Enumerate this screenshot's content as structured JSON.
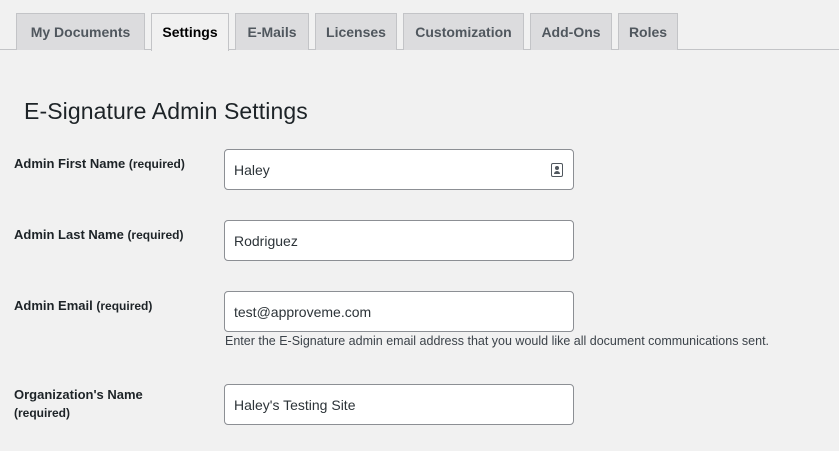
{
  "tabs": [
    {
      "label": "My Documents",
      "active": false
    },
    {
      "label": "Settings",
      "active": true
    },
    {
      "label": "E-Mails",
      "active": false
    },
    {
      "label": "Licenses",
      "active": false
    },
    {
      "label": "Customization",
      "active": false
    },
    {
      "label": "Add-Ons",
      "active": false
    },
    {
      "label": "Roles",
      "active": false
    }
  ],
  "page_title": "E-Signature Admin Settings",
  "fields": {
    "first_name": {
      "label": "Admin First Name",
      "required": "(required)",
      "value": "Haley",
      "icon": "contact-card-icon"
    },
    "last_name": {
      "label": "Admin Last Name",
      "required": "(required)",
      "value": "Rodriguez"
    },
    "email": {
      "label": "Admin Email",
      "required": "(required)",
      "value": "test@approveme.com",
      "help": "Enter the E-Signature admin email address that you would like all document communications sent."
    },
    "org_name": {
      "label": "Organization's Name",
      "required": "(required)",
      "value": "Haley's Testing Site"
    }
  },
  "colors": {
    "background": "#f1f1f1",
    "tab_inactive": "#dcdcde",
    "border": "#8c8f94"
  }
}
